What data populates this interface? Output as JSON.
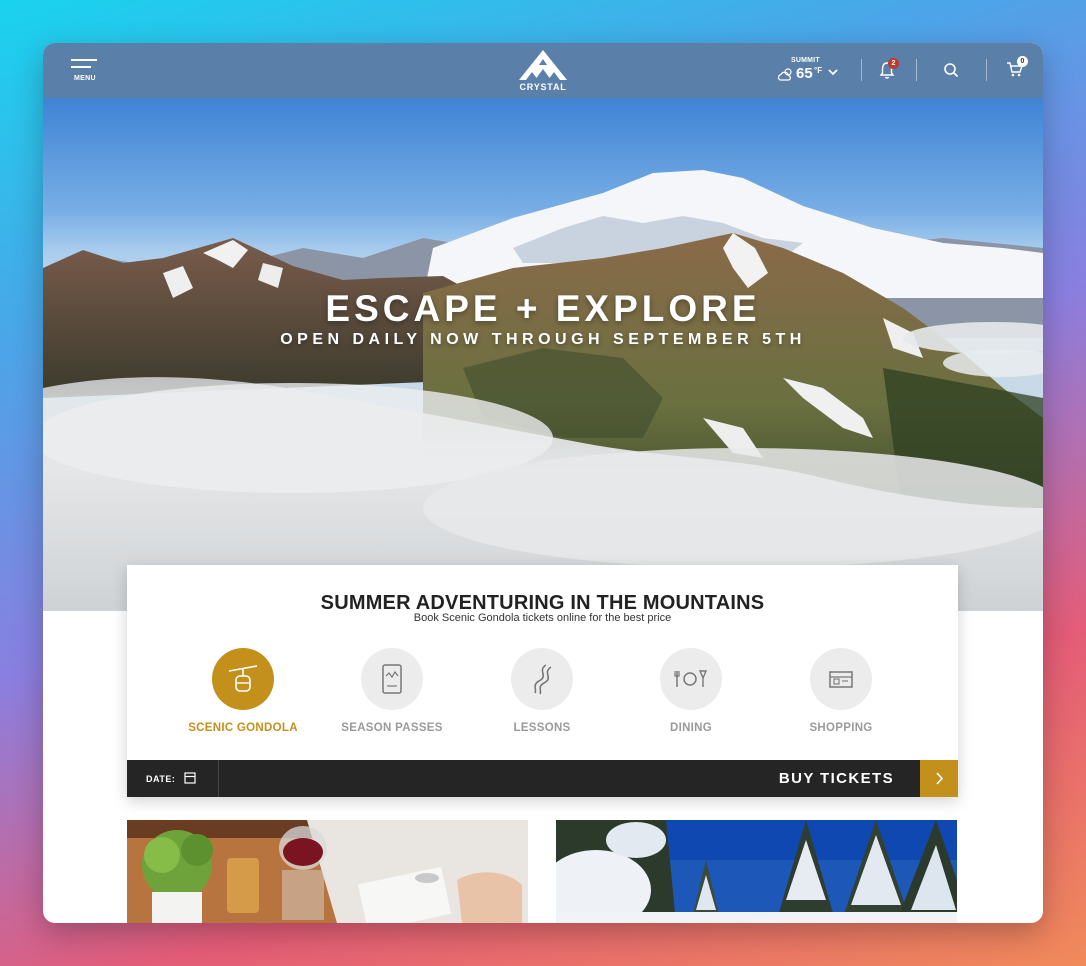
{
  "nav": {
    "menu_label": "MENU",
    "logo_text": "CRYSTAL",
    "weather": {
      "location": "SUMMIT",
      "temp": "65",
      "unit": "°F"
    },
    "alerts_count": "2",
    "cart_count": "0"
  },
  "hero": {
    "title": "ESCAPE + EXPLORE",
    "subtitle": "OPEN DAILY NOW THROUGH SEPTEMBER 5TH"
  },
  "booking": {
    "title": "SUMMER ADVENTURING IN THE MOUNTAINS",
    "subtitle": "Book Scenic Gondola tickets online for the best price",
    "categories": [
      {
        "label": "SCENIC GONDOLA",
        "icon": "gondola-icon",
        "active": true
      },
      {
        "label": "SEASON PASSES",
        "icon": "pass-card-icon",
        "active": false
      },
      {
        "label": "LESSONS",
        "icon": "trail-icon",
        "active": false
      },
      {
        "label": "DINING",
        "icon": "dining-icon",
        "active": false
      },
      {
        "label": "SHOPPING",
        "icon": "shop-icon",
        "active": false
      }
    ],
    "date_label": "DATE:",
    "buy_label": "BUY TICKETS"
  },
  "colors": {
    "accent": "#c4901c",
    "nav_bg": "#5a7fa9",
    "bar_bg": "#252525"
  }
}
